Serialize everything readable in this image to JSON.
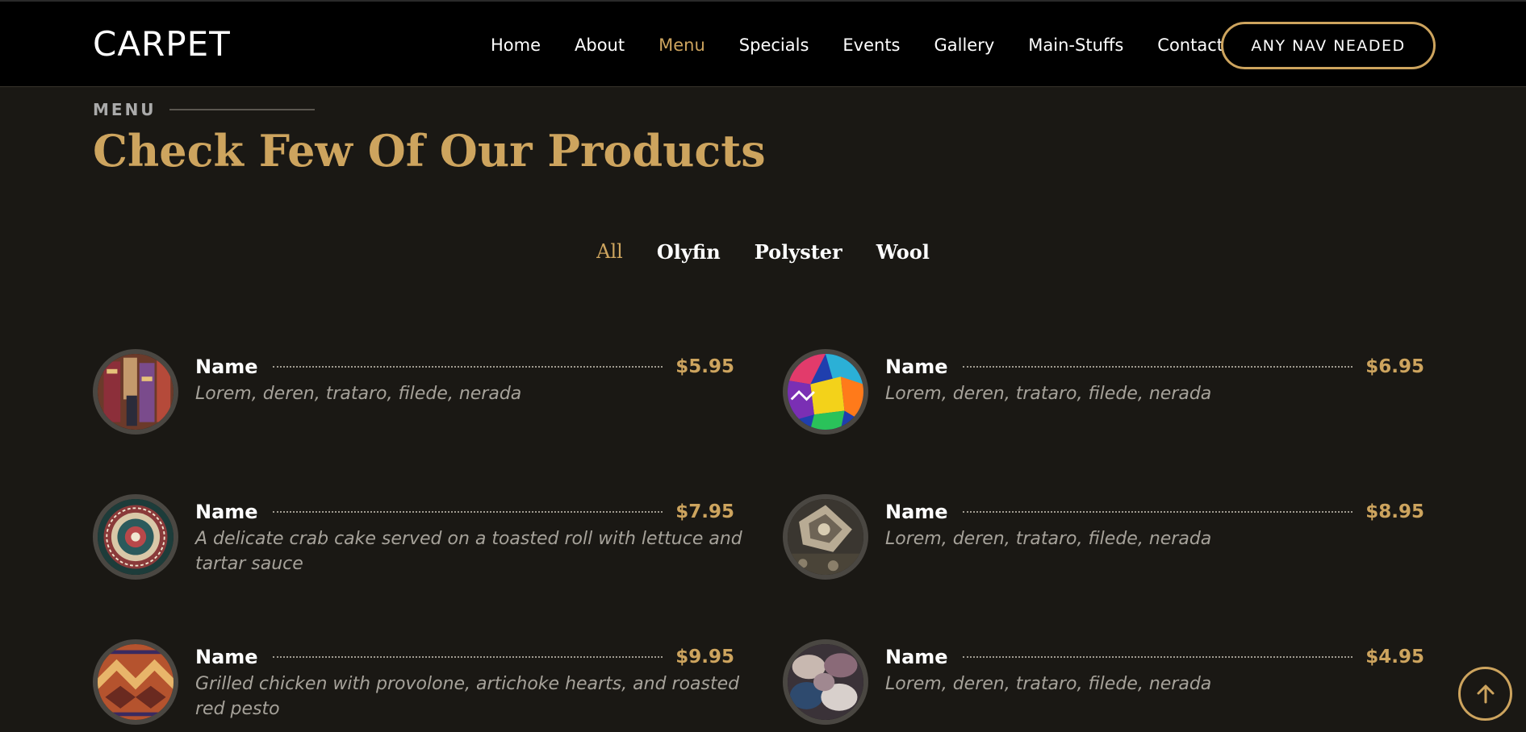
{
  "header": {
    "logo": "CARPET",
    "nav": [
      {
        "label": "Home"
      },
      {
        "label": "About"
      },
      {
        "label": "Menu",
        "active": true
      },
      {
        "label": "Specials"
      },
      {
        "label": "Events"
      },
      {
        "label": "Gallery"
      },
      {
        "label": "Main-Stuffs"
      },
      {
        "label": "Contact"
      }
    ],
    "cta_label": "ANY NAV NEADED"
  },
  "section": {
    "label": "MENU",
    "title": "Check Few Of Our Products"
  },
  "filters": [
    {
      "label": "All",
      "active": true
    },
    {
      "label": "Olyfin"
    },
    {
      "label": "Polyster"
    },
    {
      "label": "Wool"
    }
  ],
  "items": [
    {
      "name": "Name",
      "price": "$5.95",
      "desc": "Lorem, deren, trataro, filede, nerada",
      "image": "market-rugs"
    },
    {
      "name": "Name",
      "price": "$6.95",
      "desc": "Lorem, deren, trataro, filede, nerada",
      "image": "colorful-textiles"
    },
    {
      "name": "Name",
      "price": "$7.95",
      "desc": "A delicate crab cake served on a toasted roll with lettuce and tartar sauce",
      "image": "medallion-rug"
    },
    {
      "name": "Name",
      "price": "$8.95",
      "desc": "Lorem, deren, trataro, filede, nerada",
      "image": "ornate-grey-rug"
    },
    {
      "name": "Name",
      "price": "$9.95",
      "desc": "Grilled chicken with provolone, artichoke hearts, and roasted red pesto",
      "image": "red-kilim-rug"
    },
    {
      "name": "Name",
      "price": "$4.95",
      "desc": "Lorem, deren, trataro, filede, nerada",
      "image": "wool-skeins"
    }
  ],
  "colors": {
    "accent": "#cda45e",
    "background": "#1a1814",
    "header": "#000000"
  },
  "icons": {
    "scroll_top": "arrow-up-icon"
  }
}
